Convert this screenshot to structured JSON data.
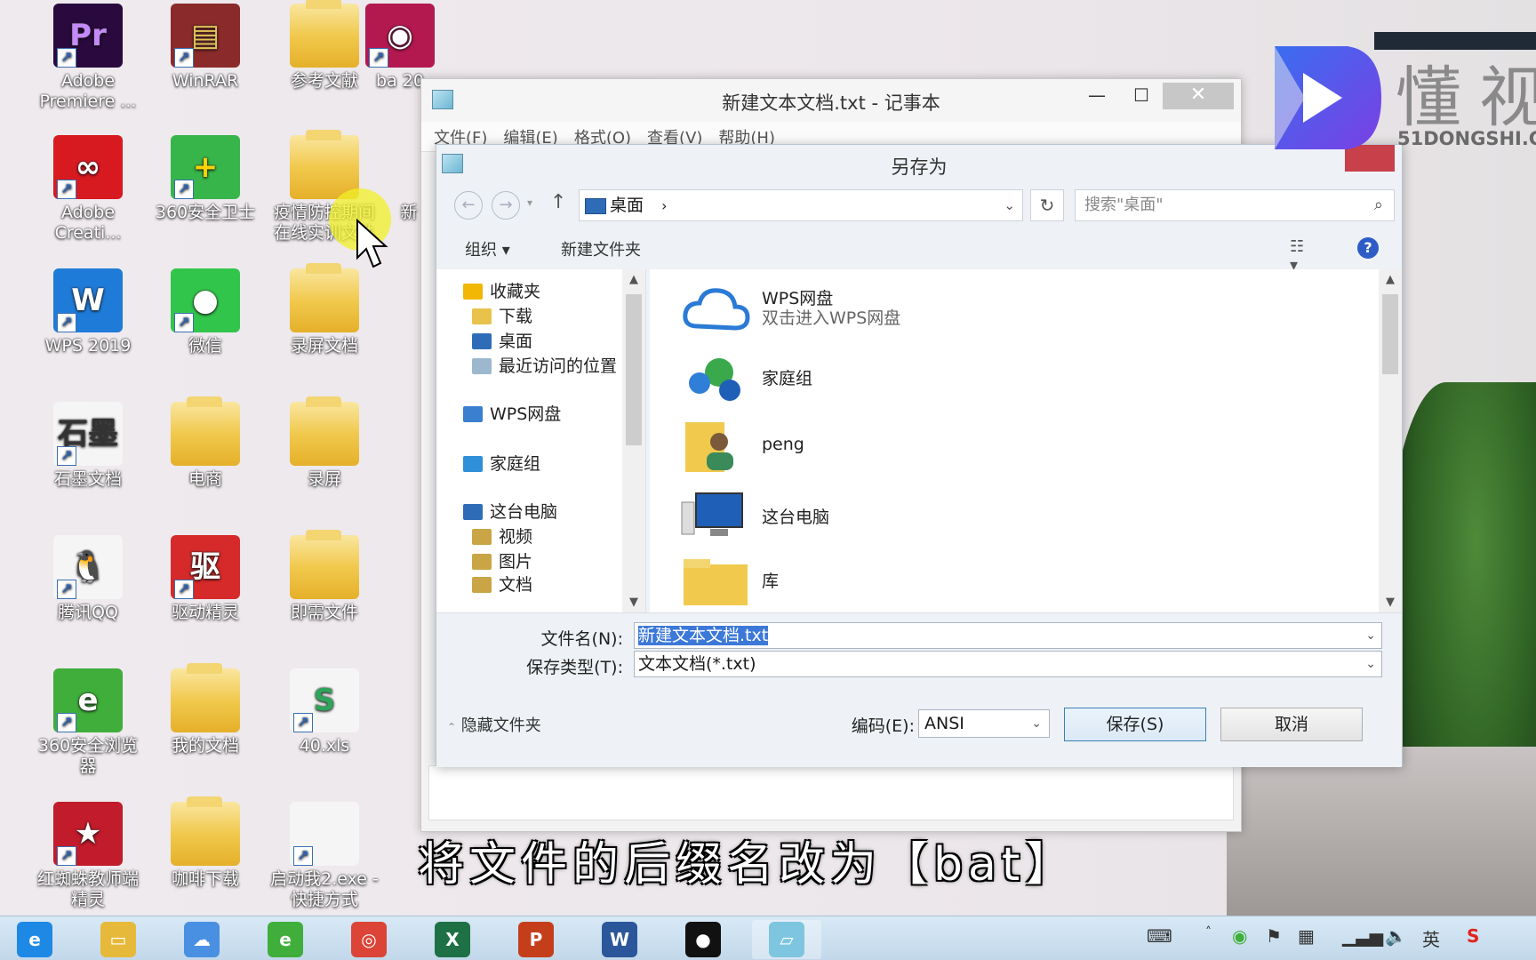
{
  "desktop": {
    "icons": [
      {
        "label": "Adobe Premiere ...",
        "glyph": "Pr",
        "color": "#2a0a3e",
        "accent": "#c48af7"
      },
      {
        "label": "WinRAR",
        "glyph": "▤",
        "color": "#8b2a2a",
        "accent": "#e5c35a"
      },
      {
        "label": "参考文献",
        "glyph": "",
        "color": "folder"
      },
      {
        "label": "ba 20",
        "glyph": "◉",
        "color": "#b3184f",
        "accent": "#fff"
      },
      {
        "label": "Adobe Creati...",
        "glyph": "∞",
        "color": "#d71920",
        "accent": "#fff"
      },
      {
        "label": "360安全卫士",
        "glyph": "+",
        "color": "#37b54a",
        "accent": "#ffd200"
      },
      {
        "label": "疫情防控期间在线实训文件",
        "glyph": "",
        "color": "folder"
      },
      {
        "label": "新",
        "glyph": "",
        "color": "none"
      },
      {
        "label": "WPS 2019",
        "glyph": "W",
        "color": "#1f7bd8",
        "accent": "#fff"
      },
      {
        "label": "微信",
        "glyph": "●",
        "color": "#32c54b",
        "accent": "#fff"
      },
      {
        "label": "录屏文档",
        "glyph": "",
        "color": "folder"
      },
      {
        "label": "石墨文档",
        "glyph": "石墨",
        "color": "#f5f5f5",
        "accent": "#333"
      },
      {
        "label": "电商",
        "glyph": "",
        "color": "folder"
      },
      {
        "label": "录屏",
        "glyph": "",
        "color": "folder"
      },
      {
        "label": "腾讯QQ",
        "glyph": "🐧",
        "color": "#f5f5f5",
        "accent": "#000"
      },
      {
        "label": "驱动精灵",
        "glyph": "驱",
        "color": "#d62a2a",
        "accent": "#fff"
      },
      {
        "label": "即需文件",
        "glyph": "",
        "color": "folder"
      },
      {
        "label": "360安全浏览器",
        "glyph": "e",
        "color": "#3fae3a",
        "accent": "#fff"
      },
      {
        "label": "我的文档",
        "glyph": "",
        "color": "folder"
      },
      {
        "label": "40.xls",
        "glyph": "S",
        "color": "#f5f5f5",
        "accent": "#2da55a"
      },
      {
        "label": "红蜘蛛教师端精灵",
        "glyph": "★",
        "color": "#c21b2b",
        "accent": "#fff"
      },
      {
        "label": "咖啡下载",
        "glyph": "",
        "color": "folder"
      },
      {
        "label": "启动我2.exe - 快捷方式",
        "glyph": "",
        "color": "#f5f5f5",
        "accent": "#999"
      }
    ]
  },
  "notepad": {
    "title": "新建文本文档.txt - 记事本",
    "min": "—",
    "max": "☐",
    "close": "✕",
    "menu": [
      "文件(F)",
      "编辑(E)",
      "格式(O)",
      "查看(V)",
      "帮助(H)"
    ]
  },
  "dialog": {
    "title": "另存为",
    "path_label": "桌面",
    "path_sep": "›",
    "search_placeholder": "搜索\"桌面\"",
    "toolbar": {
      "organize": "组织 ▾",
      "new_folder": "新建文件夹",
      "help": "?"
    },
    "nav": [
      {
        "label": "收藏夹",
        "icon": "star-icon",
        "level": 0
      },
      {
        "label": "下载",
        "icon": "download-folder-icon",
        "level": 1
      },
      {
        "label": "桌面",
        "icon": "desktop-icon",
        "level": 1
      },
      {
        "label": "最近访问的位置",
        "icon": "recent-places-icon",
        "level": 1
      },
      {
        "label": "WPS网盘",
        "icon": "cloud-icon",
        "level": 0
      },
      {
        "label": "家庭组",
        "icon": "homegroup-icon",
        "level": 0
      },
      {
        "label": "这台电脑",
        "icon": "computer-icon",
        "level": 0
      },
      {
        "label": "视频",
        "icon": "video-folder-icon",
        "level": 1
      },
      {
        "label": "图片",
        "icon": "pictures-folder-icon",
        "level": 1
      },
      {
        "label": "文档",
        "icon": "documents-folder-icon",
        "level": 1
      }
    ],
    "items": [
      {
        "name": "WPS网盘",
        "sub": "双击进入WPS网盘",
        "icon": "cloud-drive-icon"
      },
      {
        "name": "家庭组",
        "sub": "",
        "icon": "homegroup-icon"
      },
      {
        "name": "peng",
        "sub": "",
        "icon": "user-folder-icon"
      },
      {
        "name": "这台电脑",
        "sub": "",
        "icon": "computer-icon"
      },
      {
        "name": "库",
        "sub": "",
        "icon": "library-folder-icon"
      }
    ],
    "filename_label": "文件名(N):",
    "filename_value": "新建文本文档.txt",
    "filetype_label": "保存类型(T):",
    "filetype_value": "文本文档(*.txt)",
    "encoding_label": "编码(E):",
    "encoding_value": "ANSI",
    "save_button": "保存(S)",
    "cancel_button": "取消",
    "hide_folders": "隐藏文件夹"
  },
  "watermark": {
    "chars": "懂视",
    "domain": "51DONGSHI.C"
  },
  "subtitle": "将文件的后缀名改为【bat】",
  "taskbar": {
    "apps": [
      {
        "name": "ie-icon",
        "glyph": "e",
        "color": "#1e88e5"
      },
      {
        "name": "file-explorer-icon",
        "glyph": "▭",
        "color": "#e6b93a"
      },
      {
        "name": "baidu-netdisk-icon",
        "glyph": "☁",
        "color": "#4a90e2"
      },
      {
        "name": "360-browser-icon",
        "glyph": "e",
        "color": "#3fae3a"
      },
      {
        "name": "chrome-icon",
        "glyph": "◎",
        "color": "#db4437"
      },
      {
        "name": "excel-icon",
        "glyph": "X",
        "color": "#1e7145"
      },
      {
        "name": "powerpoint-icon",
        "glyph": "P",
        "color": "#c43e1c"
      },
      {
        "name": "word-icon",
        "glyph": "W",
        "color": "#2b579a"
      },
      {
        "name": "record-icon",
        "glyph": "●",
        "color": "#111"
      },
      {
        "name": "notepad-icon",
        "glyph": "▱",
        "color": "#7ec6e0"
      }
    ],
    "tray": {
      "ime": "英",
      "keyboard": "⌨",
      "up": "˄",
      "volume": "🔈",
      "sogou": "S"
    }
  },
  "colors": {
    "accent": "#3c78d8",
    "close_red": "#c8404a",
    "selection": "#3c78d8"
  }
}
